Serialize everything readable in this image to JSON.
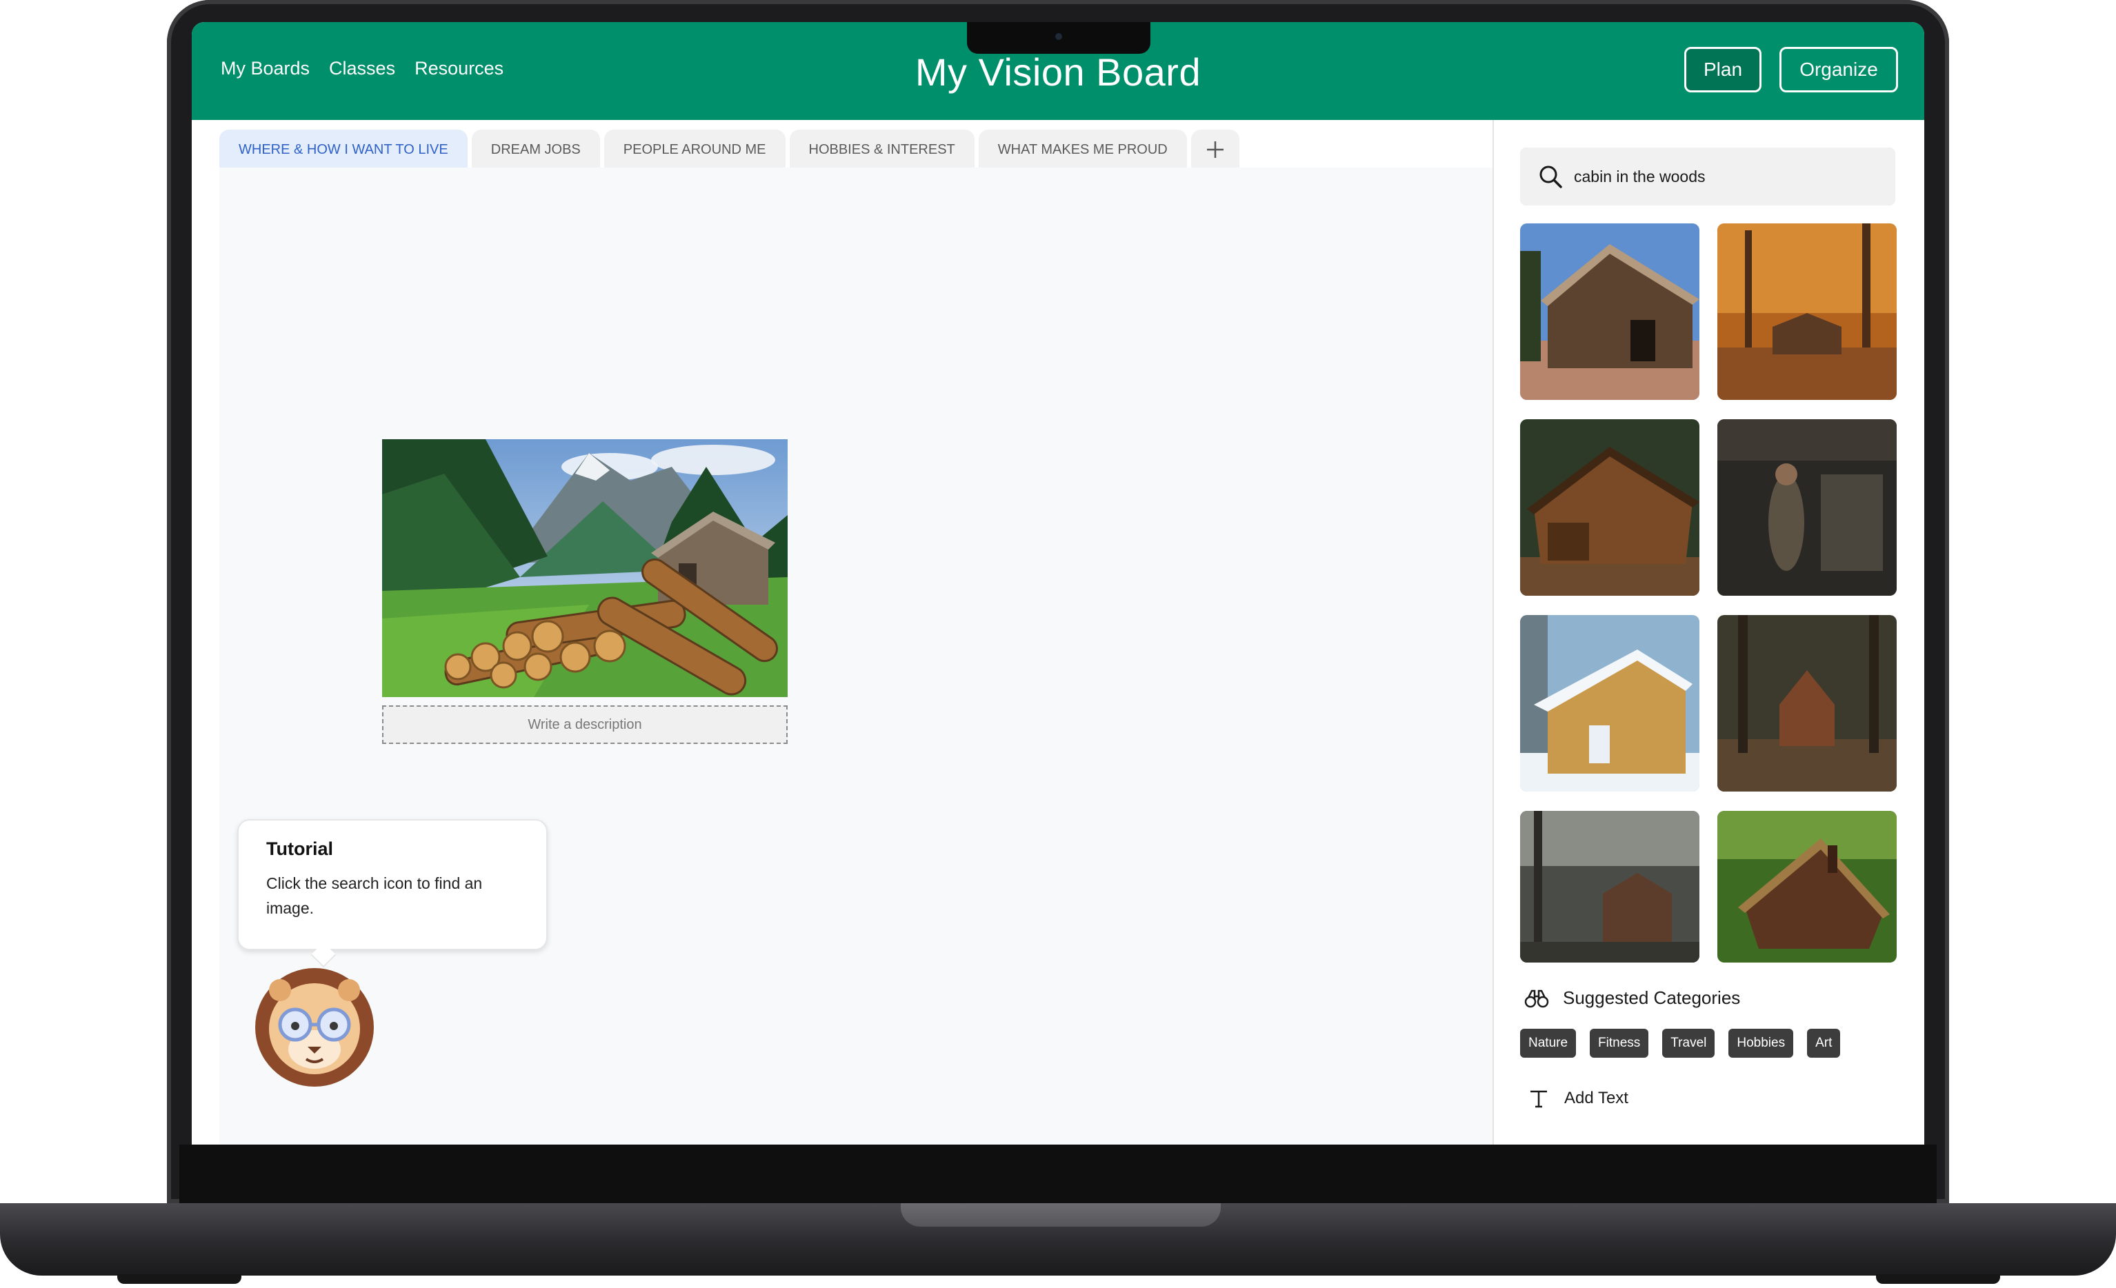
{
  "header": {
    "nav": [
      "My Boards",
      "Classes",
      "Resources"
    ],
    "title": "My Vision Board",
    "plan_label": "Plan",
    "organize_label": "Organize"
  },
  "tabs": [
    {
      "label": "WHERE & HOW I WANT TO LIVE",
      "active": true
    },
    {
      "label": "DREAM JOBS",
      "active": false
    },
    {
      "label": "PEOPLE AROUND ME",
      "active": false
    },
    {
      "label": "HOBBIES & INTEREST",
      "active": false
    },
    {
      "label": "WHAT MAKES ME PROUD",
      "active": false
    }
  ],
  "add_tab_label": "+",
  "board": {
    "description_placeholder": "Write a description"
  },
  "tutorial": {
    "title": "Tutorial",
    "text": "Click the search icon to find an image."
  },
  "sidebar": {
    "search_value": "cabin in the woods",
    "suggested_title": "Suggested Categories",
    "categories": [
      "Nature",
      "Fitness",
      "Travel",
      "Hobbies",
      "Art"
    ],
    "add_text_label": "Add Text"
  },
  "colors": {
    "brand_green": "#008f6b",
    "plan_button": "#007455",
    "active_tab_text": "#2f61c8",
    "active_tab_bg": "#e3edfb",
    "chip_bg": "#3d3d3d"
  },
  "icons": {
    "search": "magnifier-icon",
    "suggested": "binoculars-icon",
    "add_text": "text-T-icon",
    "add_tab": "plus-icon",
    "mascot": "lion-mascot"
  }
}
